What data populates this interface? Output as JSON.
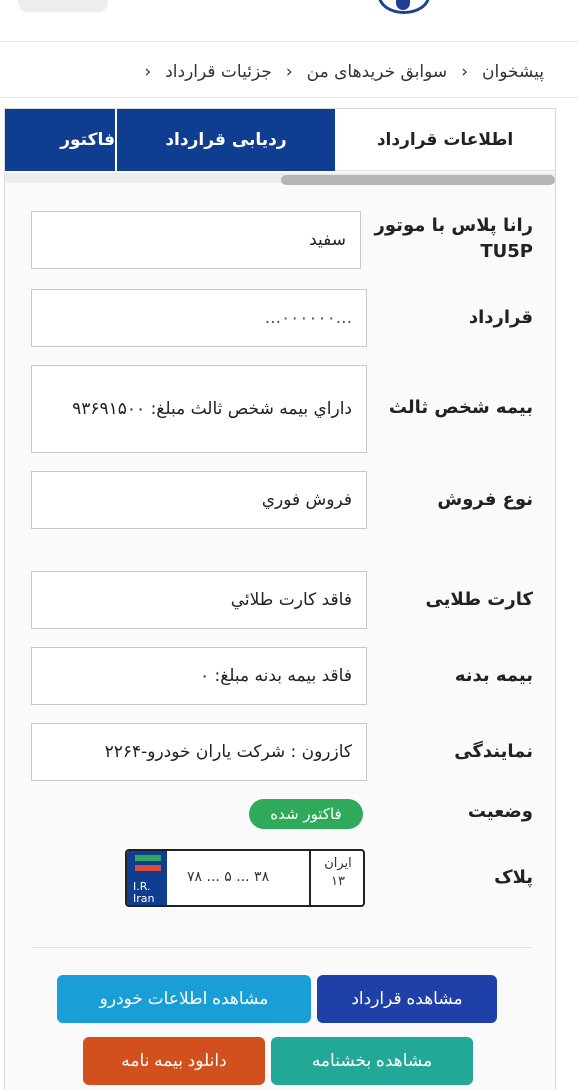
{
  "breadcrumb": {
    "items": [
      "پیشخوان",
      "سوابق خریدهای من",
      "جزئیات قرارداد"
    ]
  },
  "tabs": [
    {
      "label": "اطلاعات قرارداد"
    },
    {
      "label": "ردیابی قرارداد"
    },
    {
      "label": "فاکتور"
    }
  ],
  "details": {
    "car": {
      "label": "رانا پلاس با موتور TU5P",
      "value": "سفید"
    },
    "contract": {
      "label": "قرارداد",
      "value": "...۰۰۰۰۰۰..."
    },
    "insurance": {
      "label": "بیمه شخص ثالث",
      "value": "داراي بيمه شخص ثالث مبلغ: ۹۳۶۹۱۵۰۰"
    },
    "sale_type": {
      "label": "نوع فروش",
      "value": "فروش فوري"
    },
    "gold_card": {
      "label": "کارت طلایی",
      "value": "فاقد کارت طلائي"
    },
    "body_insurance": {
      "label": "بیمه بدنه",
      "value": "فاقد بيمه بدنه مبلغ: ۰"
    },
    "agency": {
      "label": "نمایندگی",
      "value": "کازرون : شرکت یاران خودرو-۲۲۶۴"
    },
    "status": {
      "label": "وضعیت",
      "value": "فاکتور شده"
    },
    "plate": {
      "label": "پلاک",
      "flag_text": "I.R. Iran",
      "region_label": "ایران",
      "region_code": "۱۳",
      "number": "۷۸ ... ۵ ... ۳۸"
    }
  },
  "buttons": {
    "view_contract": "مشاهده قرارداد",
    "view_car_info": "مشاهده اطلاعات خودرو",
    "view_circular": "مشاهده بخشنامه",
    "download_insurance": "دانلود بیمه نامه"
  },
  "colors": {
    "primary_blue": "#0f3d8f",
    "button_blue": "#1e40a8",
    "button_cyan": "#1a9ed6",
    "button_teal": "#22a897",
    "button_orange": "#d2501d",
    "status_green": "#2eaa5a"
  }
}
